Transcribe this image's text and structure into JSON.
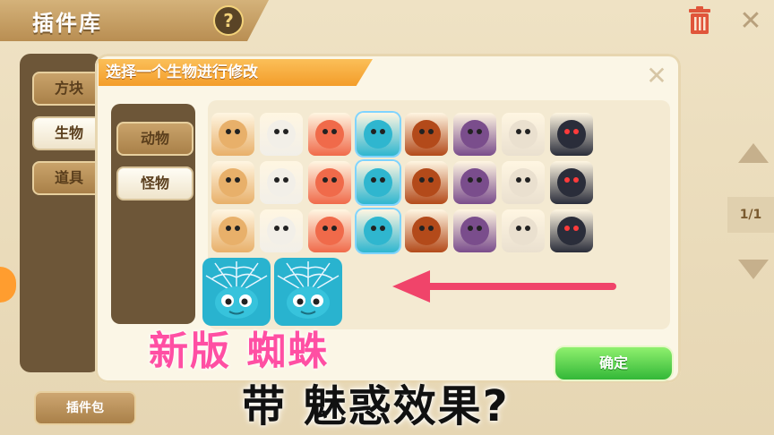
{
  "window": {
    "title": "插件库",
    "help_label": "?",
    "close_icon": "close-icon",
    "trash_icon": "trash-icon"
  },
  "sidebar": {
    "items": [
      {
        "label": "方块",
        "selected": false
      },
      {
        "label": "生物",
        "selected": true
      },
      {
        "label": "道具",
        "selected": false
      }
    ],
    "pack_label": "插件包"
  },
  "pager": {
    "page": "1/1",
    "up_icon": "triangle-up-icon",
    "down_icon": "triangle-down-icon"
  },
  "dialog": {
    "title": "选择一个生物进行修改",
    "close_icon": "close-icon",
    "types": [
      {
        "label": "动物",
        "selected": false
      },
      {
        "label": "怪物",
        "selected": true
      }
    ],
    "confirm_label": "确定",
    "grid": {
      "rows": [
        [
          "bear-warrior",
          "white-cat-monster",
          "red-demon",
          "spider",
          "lava-golem",
          "purple-block-monster",
          "skeleton",
          "hooded-ghost"
        ],
        [
          "bear-warrior",
          "white-cat-monster",
          "red-demon",
          "spider",
          "lava-golem",
          "purple-block-monster",
          "skeleton",
          "hooded-ghost"
        ],
        [
          "bear-warrior",
          "white-cat-monster",
          "red-demon",
          "spider",
          "lava-golem",
          "purple-block-monster",
          "skeleton",
          "hooded-ghost"
        ]
      ],
      "large_previews": [
        "spider",
        "spider"
      ],
      "colors": {
        "bear-warrior": "#e8b06a",
        "white-cat-monster": "#f2efe8",
        "red-demon": "#f06a4a",
        "spider": "#2fb6cf",
        "lava-golem": "#b34a1a",
        "purple-block-monster": "#7a4d8c",
        "skeleton": "#eae0cf",
        "hooded-ghost": "#2a2d3a"
      }
    }
  },
  "overlay_text": {
    "line1": "新版 蜘蛛",
    "line2": "带 魅惑效果?"
  },
  "colors": {
    "overlay_pink": "#ff4fa3",
    "arrow_red": "#f0446a",
    "confirm_green": "#4fcf44"
  }
}
